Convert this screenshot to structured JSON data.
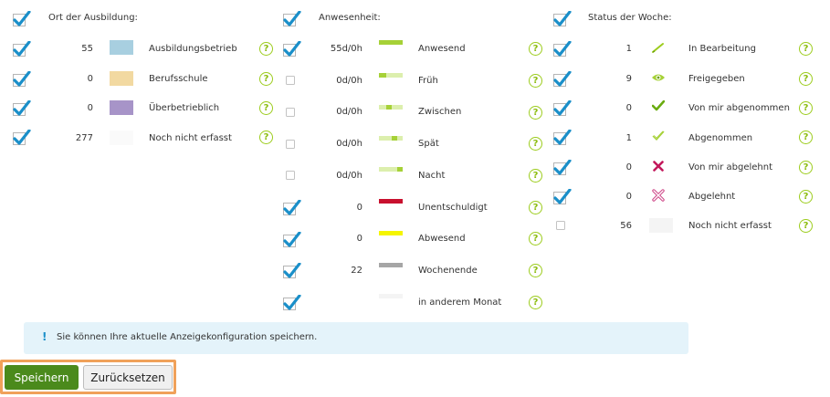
{
  "sections": {
    "ort": {
      "title": "Ort der Ausbildung:",
      "rows": [
        {
          "count": "55",
          "label": "Ausbildungsbetrieb",
          "color": "#a8cfe0"
        },
        {
          "count": "0",
          "label": "Berufsschule",
          "color": "#f2d9a1"
        },
        {
          "count": "0",
          "label": "Überbetrieblich",
          "color": "#a794c8"
        },
        {
          "count": "277",
          "label": "Noch nicht erfasst",
          "color": "#fafafa"
        }
      ]
    },
    "anwesenheit": {
      "title": "Anwesenheit:",
      "rows": [
        {
          "count": "55d/0h",
          "label": "Anwesend",
          "checked": true
        },
        {
          "count": "0d/0h",
          "label": "Früh",
          "checked": false
        },
        {
          "count": "0d/0h",
          "label": "Zwischen",
          "checked": false
        },
        {
          "count": "0d/0h",
          "label": "Spät",
          "checked": false
        },
        {
          "count": "0d/0h",
          "label": "Nacht",
          "checked": false
        },
        {
          "count": "0",
          "label": "Unentschuldigt",
          "checked": true,
          "color": "#c8102e"
        },
        {
          "count": "0",
          "label": "Abwesend",
          "checked": true,
          "color": "#f5f500"
        },
        {
          "count": "22",
          "label": "Wochenende",
          "checked": true,
          "color": "#a6a6a6"
        },
        {
          "count": "",
          "label": "in anderem Monat",
          "checked": true,
          "color": "#f7f7f7"
        }
      ]
    },
    "status": {
      "title": "Status der Woche:",
      "rows": [
        {
          "count": "1",
          "label": "In Bearbeitung",
          "icon": "pencil-icon",
          "checked": true
        },
        {
          "count": "9",
          "label": "Freigegeben",
          "icon": "eye-icon",
          "checked": true
        },
        {
          "count": "0",
          "label": "Von mir abgenommen",
          "icon": "check-icon",
          "checked": true
        },
        {
          "count": "1",
          "label": "Abgenommen",
          "icon": "check-outline-icon",
          "checked": true
        },
        {
          "count": "0",
          "label": "Von mir abgelehnt",
          "icon": "cross-icon",
          "checked": true
        },
        {
          "count": "0",
          "label": "Abgelehnt",
          "icon": "cross-outline-icon",
          "checked": true
        },
        {
          "count": "56",
          "label": "Noch nicht erfasst",
          "icon": "empty-swatch",
          "checked": false
        }
      ]
    }
  },
  "help_glyph": "?",
  "info": {
    "icon": "!",
    "text": "Sie können Ihre aktuelle Anzeigekonfiguration speichern."
  },
  "buttons": {
    "save": "Speichern",
    "reset": "Zurücksetzen"
  },
  "colors": {
    "check": "#1a8fc9",
    "presence_green": "#a6d137",
    "presence_light": "#dcefad",
    "help": "#9ccc1c",
    "info_bg": "#e4f3fa",
    "save_bg": "#4b8a1c",
    "highlight": "#f0a15a"
  }
}
